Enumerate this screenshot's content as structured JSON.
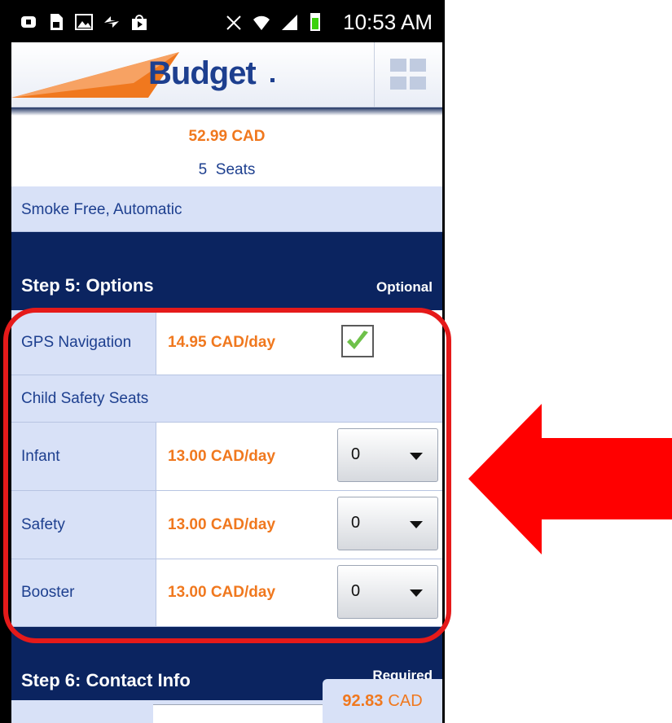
{
  "status_bar": {
    "time": "10:53 AM",
    "icons": [
      "usb-icon",
      "sim-icon",
      "gallery-icon",
      "sync-icon",
      "play-store-icon",
      "mute-icon",
      "wifi-icon",
      "signal-icon",
      "battery-icon"
    ]
  },
  "header": {
    "brand": "Budget",
    "menu_icon": "grid-menu-icon"
  },
  "vehicle": {
    "price": "52.99 CAD",
    "seats_count": "5",
    "seats_label": "Seats",
    "features": "Smoke Free, Automatic"
  },
  "step5": {
    "title": "Step 5: Options",
    "tag": "Optional",
    "options": {
      "gps": {
        "label": "GPS Navigation",
        "price": "14.95 CAD/day",
        "checked": true
      },
      "child_header": "Child Safety Seats",
      "infant": {
        "label": "Infant",
        "price": "13.00 CAD/day",
        "value": "0"
      },
      "safety": {
        "label": "Safety",
        "price": "13.00 CAD/day",
        "value": "0"
      },
      "booster": {
        "label": "Booster",
        "price": "13.00 CAD/day",
        "value": "0"
      }
    }
  },
  "step6": {
    "title": "Step 6: Contact Info",
    "tag": "Required"
  },
  "total": {
    "amount": "92.83",
    "currency": "CAD"
  },
  "colors": {
    "accent_orange": "#f0781e",
    "brand_blue": "#1d3f8f",
    "navy": "#0b2460",
    "light_blue": "#d8e1f7",
    "annotation_red": "#e51a1a"
  }
}
